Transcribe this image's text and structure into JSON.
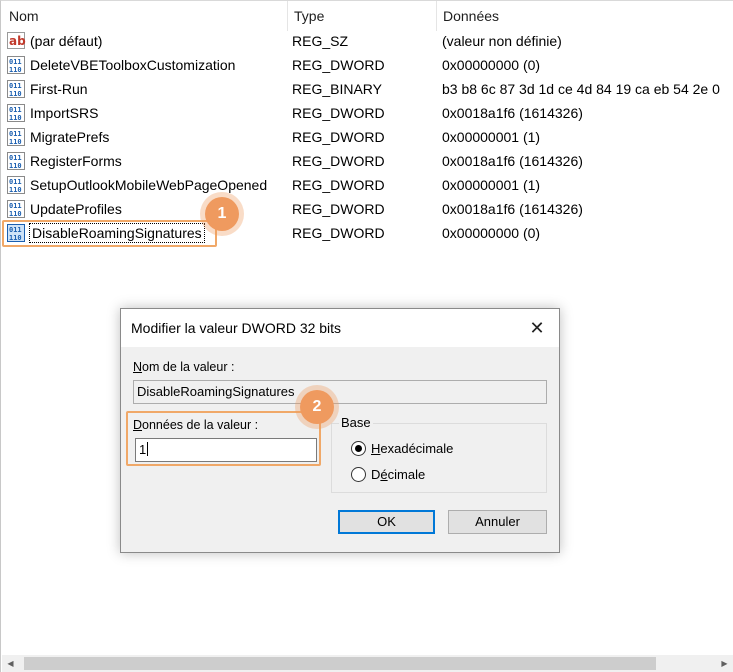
{
  "columns": {
    "name": "Nom",
    "type": "Type",
    "data": "Données"
  },
  "rows": [
    {
      "icon": "string-value-icon",
      "name": "(par défaut)",
      "type": "REG_SZ",
      "data": "(valeur non définie)"
    },
    {
      "icon": "binary-value-icon",
      "name": "DeleteVBEToolboxCustomization",
      "type": "REG_DWORD",
      "data": "0x00000000 (0)"
    },
    {
      "icon": "binary-value-icon",
      "name": "First-Run",
      "type": "REG_BINARY",
      "data": "b3 b8 6c 87 3d 1d ce 4d 84 19 ca eb 54 2e 0"
    },
    {
      "icon": "binary-value-icon",
      "name": "ImportSRS",
      "type": "REG_DWORD",
      "data": "0x0018a1f6 (1614326)"
    },
    {
      "icon": "binary-value-icon",
      "name": "MigratePrefs",
      "type": "REG_DWORD",
      "data": "0x00000001 (1)"
    },
    {
      "icon": "binary-value-icon",
      "name": "RegisterForms",
      "type": "REG_DWORD",
      "data": "0x0018a1f6 (1614326)"
    },
    {
      "icon": "binary-value-icon",
      "name": "SetupOutlookMobileWebPageOpened",
      "type": "REG_DWORD",
      "data": "0x00000001 (1)"
    },
    {
      "icon": "binary-value-icon",
      "name": "UpdateProfiles",
      "type": "REG_DWORD",
      "data": "0x0018a1f6 (1614326)"
    },
    {
      "icon": "binary-value-icon",
      "name": "DisableRoamingSignatures",
      "type": "REG_DWORD",
      "data": "0x00000000 (0)"
    }
  ],
  "badges": {
    "one": "1",
    "two": "2"
  },
  "dialog": {
    "title": "Modifier la valeur DWORD 32 bits",
    "close": "✕",
    "name_label_key": "N",
    "name_label_rest": "om de la valeur :",
    "name_value": "DisableRoamingSignatures",
    "data_label_key": "D",
    "data_label_rest": "onnées de la valeur :",
    "data_value": "1",
    "base_label": "Base",
    "hex_key": "H",
    "hex_rest": "exadécimale",
    "dec_pre": "D",
    "dec_key": "é",
    "dec_rest": "cimale",
    "selected_base": "hex",
    "ok": "OK",
    "cancel": "Annuler"
  },
  "colors": {
    "highlight": "#f0a868",
    "badge": "#ef9a5f",
    "accent": "#0078d7"
  }
}
